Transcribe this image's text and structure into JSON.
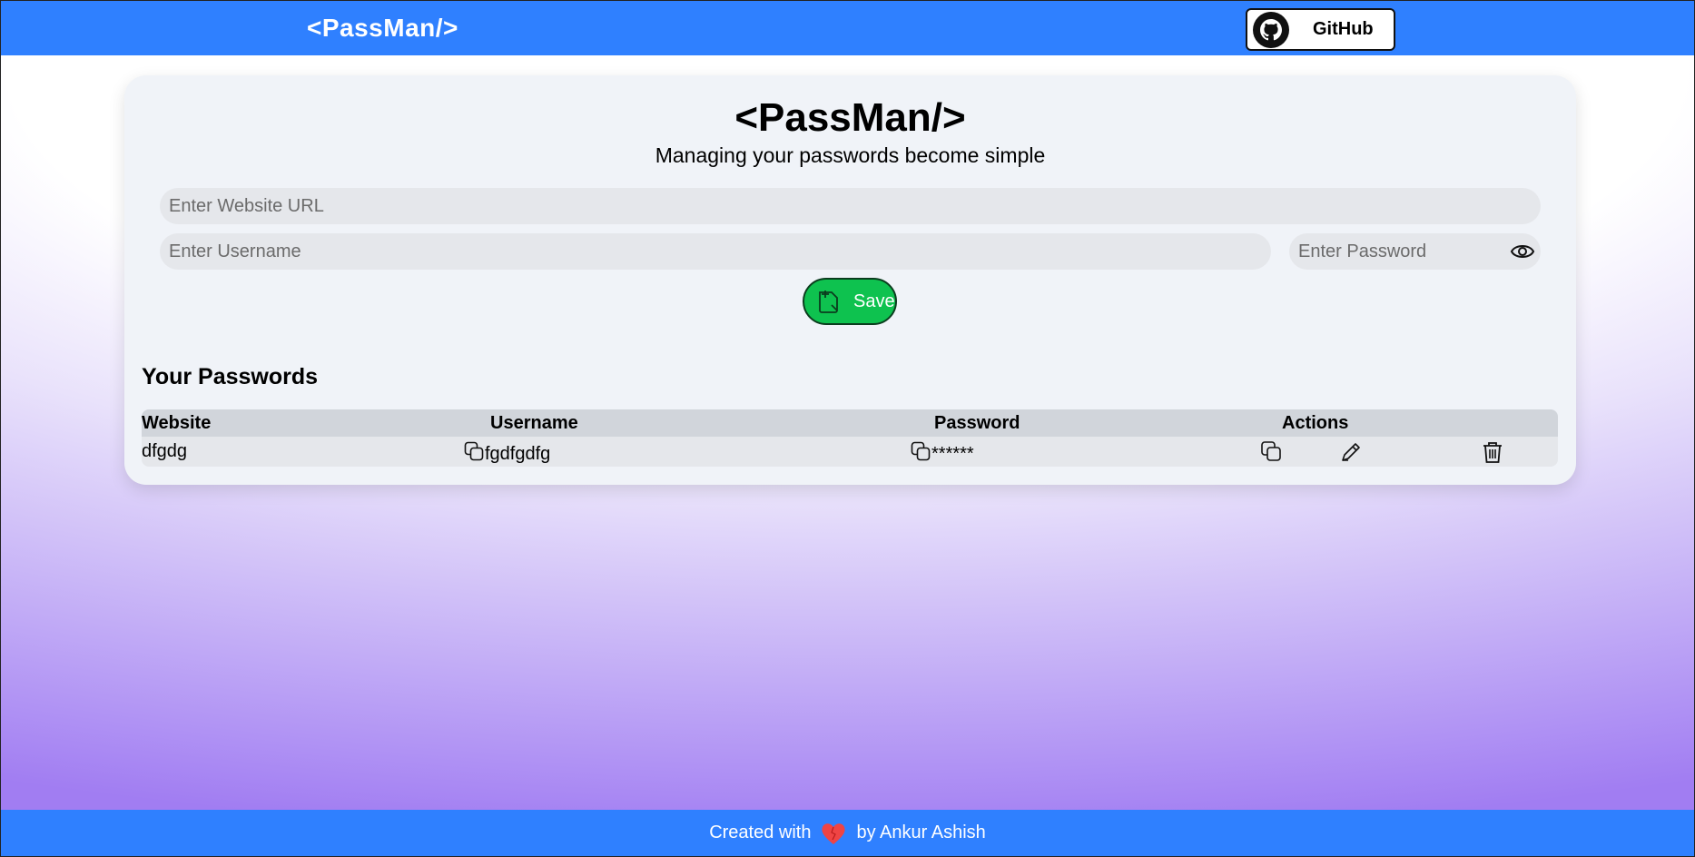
{
  "navbar": {
    "logo": "<PassMan/>",
    "github_label": "GitHub"
  },
  "card": {
    "title": "<PassMan/>",
    "subtitle": "Managing your passwords become simple",
    "url_placeholder": "Enter Website URL",
    "username_placeholder": "Enter Username",
    "password_placeholder": "Enter Password",
    "save_label": "Save"
  },
  "passwords": {
    "heading": "Your Passwords",
    "columns": [
      "Website",
      "Username",
      "Password",
      "Actions"
    ],
    "rows": [
      {
        "website": "dfgdg",
        "username": "fgdfgdfg",
        "password": "******"
      }
    ]
  },
  "footer": {
    "prefix": "Created with",
    "suffix": "by Ankur Ashish"
  },
  "colors": {
    "brand_blue": "#2f80ff",
    "save_green": "#0ec24f",
    "heart_red": "#ef4444"
  },
  "icons": [
    "github-icon",
    "eye-icon",
    "add-note-icon",
    "copy-icon",
    "edit-icon",
    "trash-icon",
    "heart-icon"
  ]
}
